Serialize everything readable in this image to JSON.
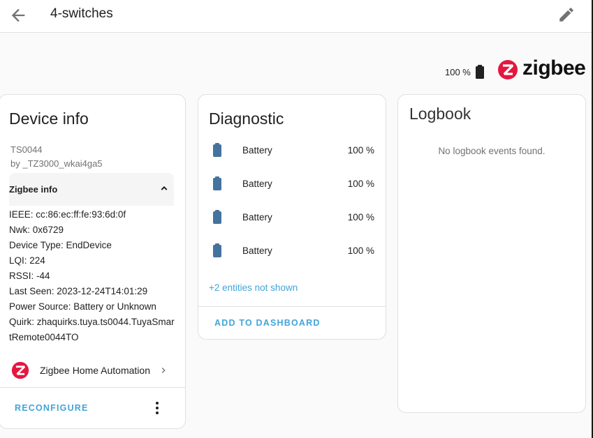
{
  "header": {
    "title": "4-switches",
    "back_icon": "arrow-left-icon",
    "edit_icon": "pencil-icon"
  },
  "status": {
    "battery_level": "100 %",
    "battery_icon": "battery-icon",
    "logo_text": "zigbee",
    "logo_icon": "zigbee-logo-icon"
  },
  "device_info": {
    "title": "Device info",
    "model": "TS0044",
    "manufacturer": "by _TZ3000_wkai4ga5",
    "zigbee_section": {
      "label": "Zigbee info",
      "expanded": true,
      "lines": [
        "IEEE: cc:86:ec:ff:fe:93:6d:0f",
        "Nwk: 0x6729",
        "Device Type: EndDevice",
        "LQI: 224",
        "RSSI: -44",
        "Last Seen: 2023-12-24T14:01:29",
        "Power Source: Battery or Unknown",
        "Quirk: zhaquirks.tuya.ts0044.TuyaSmartRemote0044TO"
      ]
    },
    "integration": "Zigbee Home Automation",
    "reconfigure_label": "RECONFIGURE"
  },
  "diagnostic": {
    "title": "Diagnostic",
    "entities": [
      {
        "name": "Battery",
        "value": "100 %",
        "icon": "battery-icon"
      },
      {
        "name": "Battery",
        "value": "100 %",
        "icon": "battery-icon"
      },
      {
        "name": "Battery",
        "value": "100 %",
        "icon": "battery-icon"
      },
      {
        "name": "Battery",
        "value": "100 %",
        "icon": "battery-icon"
      }
    ],
    "hidden_entities": "+2 entities not shown",
    "add_to_dashboard_label": "ADD TO DASHBOARD"
  },
  "logbook": {
    "title": "Logbook",
    "empty_message": "No logbook events found."
  },
  "colors": {
    "accent": "#42a5d8",
    "entity_icon": "#44739e",
    "zigbee_red": "#e5173f"
  }
}
